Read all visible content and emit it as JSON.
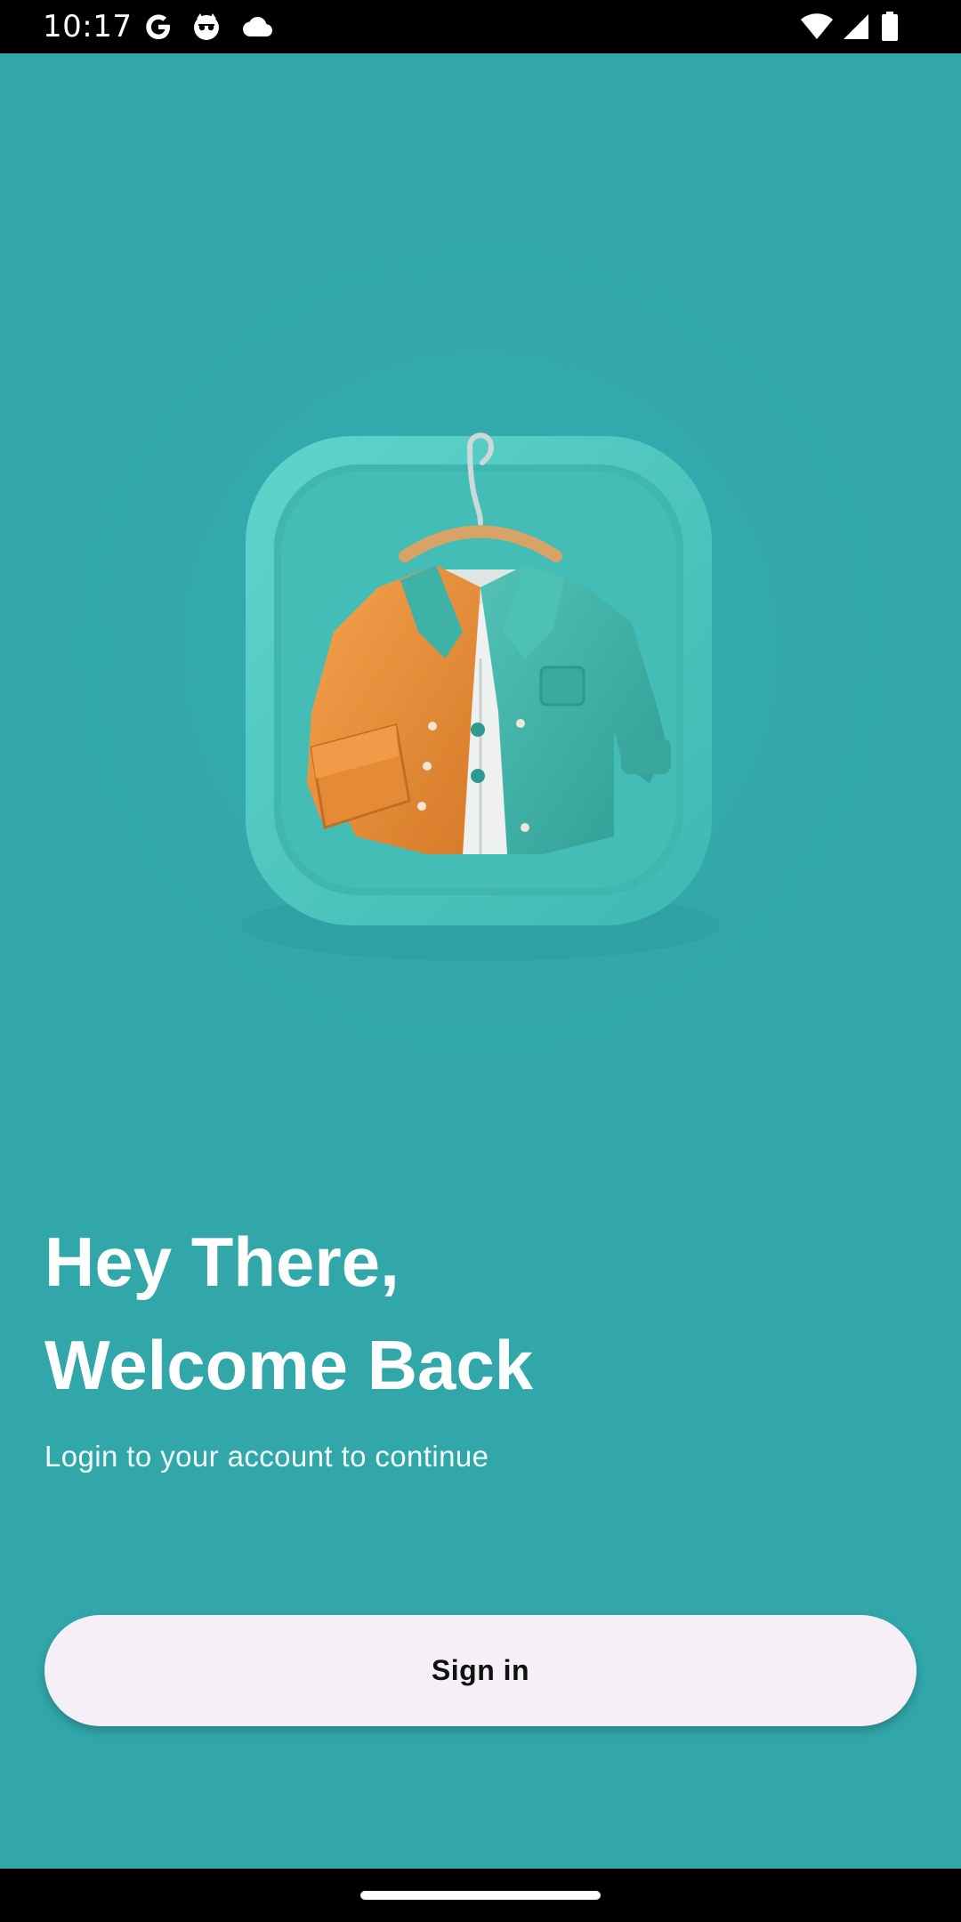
{
  "status_bar": {
    "time": "10:17",
    "left_icons": [
      "google-g-icon",
      "robot-face-icon",
      "cloud-icon"
    ],
    "right_icons": [
      "wifi-icon",
      "cellular-signal-icon",
      "battery-icon"
    ]
  },
  "illustration": {
    "name": "jacket-on-hanger-app-icon",
    "colors": {
      "background": "#31a7aa",
      "tile": "#4cc6c1",
      "jacket_left": "#ee9340",
      "jacket_right": "#3fb2a8",
      "shirt": "#eef1f0"
    }
  },
  "welcome": {
    "headline_line1": "Hey There,",
    "headline_line2": "Welcome Back",
    "subtitle": "Login to your account to continue"
  },
  "actions": {
    "signin_label": "Sign in"
  },
  "colors": {
    "background": "#31a7aa",
    "button_bg": "#f5eff7",
    "button_text": "#111111",
    "headline": "#ffffff"
  }
}
